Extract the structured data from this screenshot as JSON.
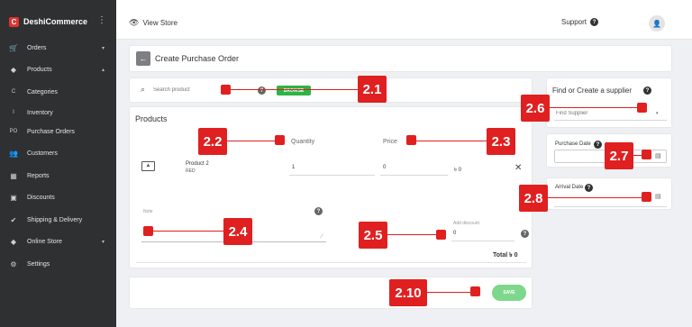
{
  "sidebar": {
    "brand": "DeshiCommerce",
    "brand_initial": "C",
    "items": [
      {
        "label": "Orders",
        "icon": "cart-icon",
        "glyph": "🛒",
        "caret": "▾"
      },
      {
        "label": "Products",
        "icon": "layers-icon",
        "glyph": "◆",
        "caret": "▴"
      },
      {
        "label": "Categories",
        "abbr": "C"
      },
      {
        "label": "Inventory",
        "abbr": "I"
      },
      {
        "label": "Purchase Orders",
        "abbr": "PO"
      },
      {
        "label": "Customers",
        "icon": "users-icon",
        "glyph": "👥"
      },
      {
        "label": "Reports",
        "icon": "chart-icon",
        "glyph": "▦"
      },
      {
        "label": "Discounts",
        "icon": "tag-icon",
        "glyph": "▣"
      },
      {
        "label": "Shipping & Delivery",
        "icon": "check-circle-icon",
        "glyph": "✔"
      },
      {
        "label": "Online Store",
        "icon": "layers-icon",
        "glyph": "◆",
        "caret": "▾"
      },
      {
        "label": "Settings",
        "icon": "gear-icon",
        "glyph": "⚙"
      }
    ]
  },
  "topbar": {
    "view_store": "View Store",
    "support": "Support"
  },
  "page": {
    "title": "Create Purchase Order",
    "back_icon": "arrow-left-icon"
  },
  "search": {
    "placeholder": "Search product",
    "browse": "BROWSE"
  },
  "products": {
    "heading": "Products",
    "col_quantity": "Quantity",
    "col_price": "Price",
    "row": {
      "name": "Product 2",
      "variant": "RED",
      "quantity": "1",
      "price": "0",
      "total": "৳ 0"
    },
    "note_label": "Note",
    "discount_label": "Add discount",
    "discount_value": "0",
    "total_label": "Total ৳ 0"
  },
  "supplier": {
    "title": "Find or Create a supplier",
    "placeholder": "Find Supplier"
  },
  "purchase_date": {
    "label": "Purchase Date"
  },
  "arrival_date": {
    "label": "Arrival Date"
  },
  "footer": {
    "save": "SAVE"
  },
  "annotations": [
    "2.1",
    "2.2",
    "2.3",
    "2.4",
    "2.5",
    "2.6",
    "2.7",
    "2.8",
    "2.10"
  ],
  "colors": {
    "annotation": "#e02020",
    "browse": "#2fb344",
    "save": "#7ed88c",
    "sidebar": "#2f3032"
  }
}
